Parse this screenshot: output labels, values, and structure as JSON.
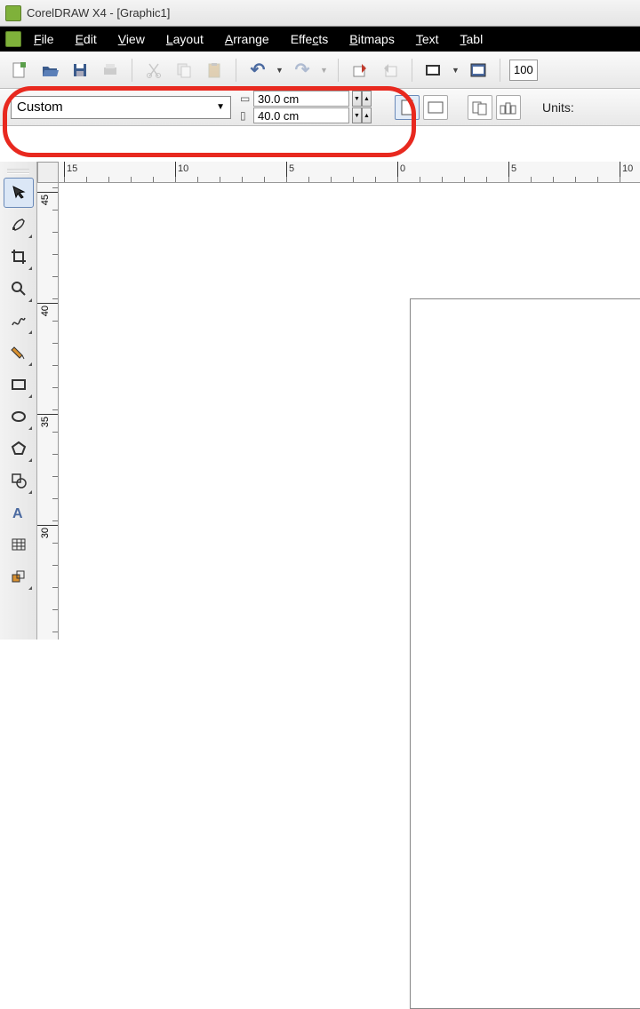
{
  "title": "CorelDRAW X4 - [Graphic1]",
  "menu": [
    "File",
    "Edit",
    "View",
    "Layout",
    "Arrange",
    "Effects",
    "Bitmaps",
    "Text",
    "Tabl"
  ],
  "toolbar1": {
    "zoom": "100"
  },
  "toolbar2": {
    "page_preset": "Custom",
    "width": "30.0 cm",
    "height": "40.0 cm",
    "units_label": "Units:"
  },
  "ruler_h": [
    {
      "pos": 30,
      "label": "15"
    },
    {
      "pos": 155,
      "label": "10"
    },
    {
      "pos": 280,
      "label": "5"
    },
    {
      "pos": 405,
      "label": "0"
    },
    {
      "pos": 530,
      "label": "5"
    },
    {
      "pos": 655,
      "label": "10"
    }
  ],
  "ruler_v": [
    {
      "pos": 10,
      "label": "45"
    },
    {
      "pos": 135,
      "label": "40"
    },
    {
      "pos": 260,
      "label": "35"
    },
    {
      "pos": 385,
      "label": "30"
    }
  ]
}
